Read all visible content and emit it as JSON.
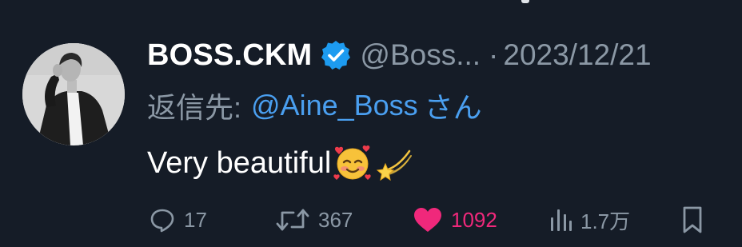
{
  "tweet": {
    "display_name": "BOSS.CKM",
    "handle": "@Boss...",
    "separator": "·",
    "timestamp": "2023/12/21",
    "reply": {
      "prefix": "返信先:",
      "handle": "@Aine_Boss",
      "suffix": "さん"
    },
    "text": "Very beautiful",
    "emojis": [
      "smiling-face-with-hearts-emoji",
      "dizzy-star-emoji"
    ]
  },
  "actions": {
    "reply_count": "17",
    "retweet_count": "367",
    "like_count": "1092",
    "views_count": "1.7万"
  },
  "colors": {
    "background": "#151c27",
    "secondary_text": "#8b98a5",
    "link": "#4a9ff0",
    "like": "#f0287b",
    "verified": "#1d9bf0"
  }
}
